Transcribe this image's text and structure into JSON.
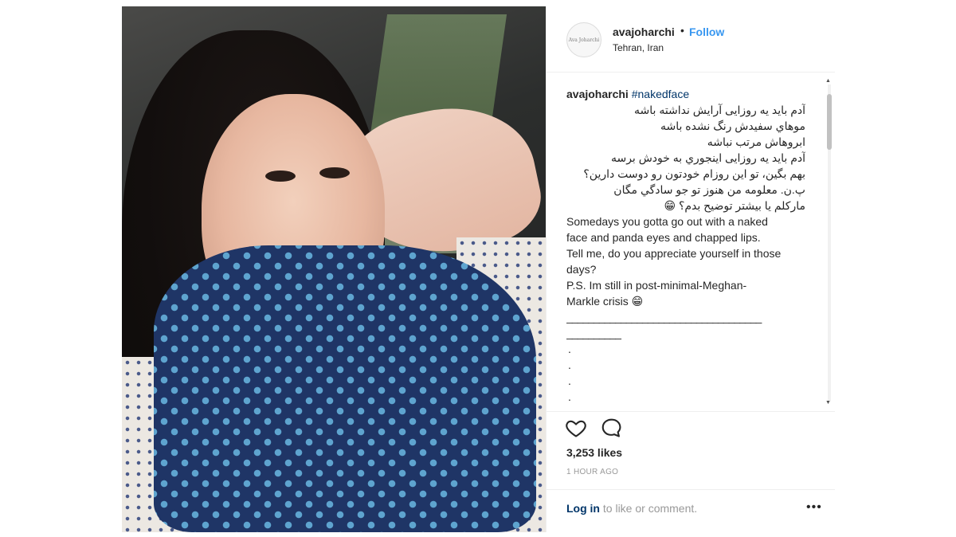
{
  "post": {
    "username": "avajoharchi",
    "separator": "•",
    "follow_label": "Follow",
    "location": "Tehran, Iran",
    "avatar_text": "Ava Joharchi"
  },
  "caption": {
    "username": "avajoharchi",
    "hashtag": "#nakedface",
    "rtl_lines": [
      "آدم باید یه روزایی آرایش نداشته باشه",
      "موهاي سفیدش رنگ نشده باشه",
      "ابروهاش مرتب نباشه",
      "آدم باید یه روزایی اینجوري به خودش برسه",
      "بهم بگین، تو این روزام خودتون رو دوست دارین؟",
      "پ.ن. معلومه من هنوز تو جو سادگي مگان",
      "ماركلم یا بیشتر توضیح بدم؟ 😁"
    ],
    "ltr_lines": [
      "Somedays you gotta go out with a naked",
      "face and panda eyes and chapped lips.",
      "Tell me, do you appreciate yourself in those",
      "days?",
      "P.S. Im still in post-minimal-Meghan-",
      "Markle crisis 😁"
    ],
    "rule_line1": "____________________________________",
    "rule_line2": "__________",
    "bullets": [
      ".",
      ".",
      ".",
      ".",
      "."
    ]
  },
  "stats": {
    "likes": "3,253 likes",
    "time_ago": "1 HOUR AGO"
  },
  "footer": {
    "login_label": "Log in",
    "login_suffix": " to like or comment.",
    "more_label": "•••"
  },
  "icons": {
    "like": "heart-icon",
    "comment": "comment-icon",
    "more": "more-options-icon"
  }
}
